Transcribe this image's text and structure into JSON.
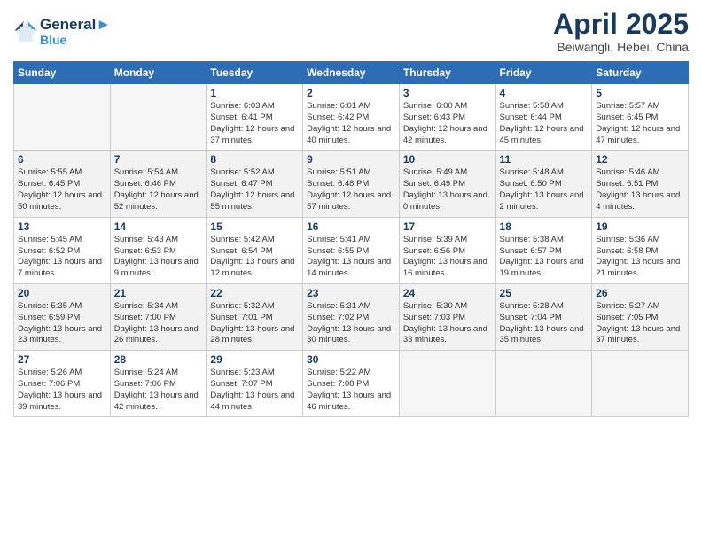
{
  "header": {
    "logo_line1": "General",
    "logo_line2": "Blue",
    "month": "April 2025",
    "location": "Beiwangli, Hebei, China"
  },
  "weekdays": [
    "Sunday",
    "Monday",
    "Tuesday",
    "Wednesday",
    "Thursday",
    "Friday",
    "Saturday"
  ],
  "weeks": [
    [
      {
        "day": "",
        "info": ""
      },
      {
        "day": "",
        "info": ""
      },
      {
        "day": "1",
        "info": "Sunrise: 6:03 AM\nSunset: 6:41 PM\nDaylight: 12 hours and 37 minutes."
      },
      {
        "day": "2",
        "info": "Sunrise: 6:01 AM\nSunset: 6:42 PM\nDaylight: 12 hours and 40 minutes."
      },
      {
        "day": "3",
        "info": "Sunrise: 6:00 AM\nSunset: 6:43 PM\nDaylight: 12 hours and 42 minutes."
      },
      {
        "day": "4",
        "info": "Sunrise: 5:58 AM\nSunset: 6:44 PM\nDaylight: 12 hours and 45 minutes."
      },
      {
        "day": "5",
        "info": "Sunrise: 5:57 AM\nSunset: 6:45 PM\nDaylight: 12 hours and 47 minutes."
      }
    ],
    [
      {
        "day": "6",
        "info": "Sunrise: 5:55 AM\nSunset: 6:45 PM\nDaylight: 12 hours and 50 minutes."
      },
      {
        "day": "7",
        "info": "Sunrise: 5:54 AM\nSunset: 6:46 PM\nDaylight: 12 hours and 52 minutes."
      },
      {
        "day": "8",
        "info": "Sunrise: 5:52 AM\nSunset: 6:47 PM\nDaylight: 12 hours and 55 minutes."
      },
      {
        "day": "9",
        "info": "Sunrise: 5:51 AM\nSunset: 6:48 PM\nDaylight: 12 hours and 57 minutes."
      },
      {
        "day": "10",
        "info": "Sunrise: 5:49 AM\nSunset: 6:49 PM\nDaylight: 13 hours and 0 minutes."
      },
      {
        "day": "11",
        "info": "Sunrise: 5:48 AM\nSunset: 6:50 PM\nDaylight: 13 hours and 2 minutes."
      },
      {
        "day": "12",
        "info": "Sunrise: 5:46 AM\nSunset: 6:51 PM\nDaylight: 13 hours and 4 minutes."
      }
    ],
    [
      {
        "day": "13",
        "info": "Sunrise: 5:45 AM\nSunset: 6:52 PM\nDaylight: 13 hours and 7 minutes."
      },
      {
        "day": "14",
        "info": "Sunrise: 5:43 AM\nSunset: 6:53 PM\nDaylight: 13 hours and 9 minutes."
      },
      {
        "day": "15",
        "info": "Sunrise: 5:42 AM\nSunset: 6:54 PM\nDaylight: 13 hours and 12 minutes."
      },
      {
        "day": "16",
        "info": "Sunrise: 5:41 AM\nSunset: 6:55 PM\nDaylight: 13 hours and 14 minutes."
      },
      {
        "day": "17",
        "info": "Sunrise: 5:39 AM\nSunset: 6:56 PM\nDaylight: 13 hours and 16 minutes."
      },
      {
        "day": "18",
        "info": "Sunrise: 5:38 AM\nSunset: 6:57 PM\nDaylight: 13 hours and 19 minutes."
      },
      {
        "day": "19",
        "info": "Sunrise: 5:36 AM\nSunset: 6:58 PM\nDaylight: 13 hours and 21 minutes."
      }
    ],
    [
      {
        "day": "20",
        "info": "Sunrise: 5:35 AM\nSunset: 6:59 PM\nDaylight: 13 hours and 23 minutes."
      },
      {
        "day": "21",
        "info": "Sunrise: 5:34 AM\nSunset: 7:00 PM\nDaylight: 13 hours and 26 minutes."
      },
      {
        "day": "22",
        "info": "Sunrise: 5:32 AM\nSunset: 7:01 PM\nDaylight: 13 hours and 28 minutes."
      },
      {
        "day": "23",
        "info": "Sunrise: 5:31 AM\nSunset: 7:02 PM\nDaylight: 13 hours and 30 minutes."
      },
      {
        "day": "24",
        "info": "Sunrise: 5:30 AM\nSunset: 7:03 PM\nDaylight: 13 hours and 33 minutes."
      },
      {
        "day": "25",
        "info": "Sunrise: 5:28 AM\nSunset: 7:04 PM\nDaylight: 13 hours and 35 minutes."
      },
      {
        "day": "26",
        "info": "Sunrise: 5:27 AM\nSunset: 7:05 PM\nDaylight: 13 hours and 37 minutes."
      }
    ],
    [
      {
        "day": "27",
        "info": "Sunrise: 5:26 AM\nSunset: 7:06 PM\nDaylight: 13 hours and 39 minutes."
      },
      {
        "day": "28",
        "info": "Sunrise: 5:24 AM\nSunset: 7:06 PM\nDaylight: 13 hours and 42 minutes."
      },
      {
        "day": "29",
        "info": "Sunrise: 5:23 AM\nSunset: 7:07 PM\nDaylight: 13 hours and 44 minutes."
      },
      {
        "day": "30",
        "info": "Sunrise: 5:22 AM\nSunset: 7:08 PM\nDaylight: 13 hours and 46 minutes."
      },
      {
        "day": "",
        "info": ""
      },
      {
        "day": "",
        "info": ""
      },
      {
        "day": "",
        "info": ""
      }
    ]
  ]
}
